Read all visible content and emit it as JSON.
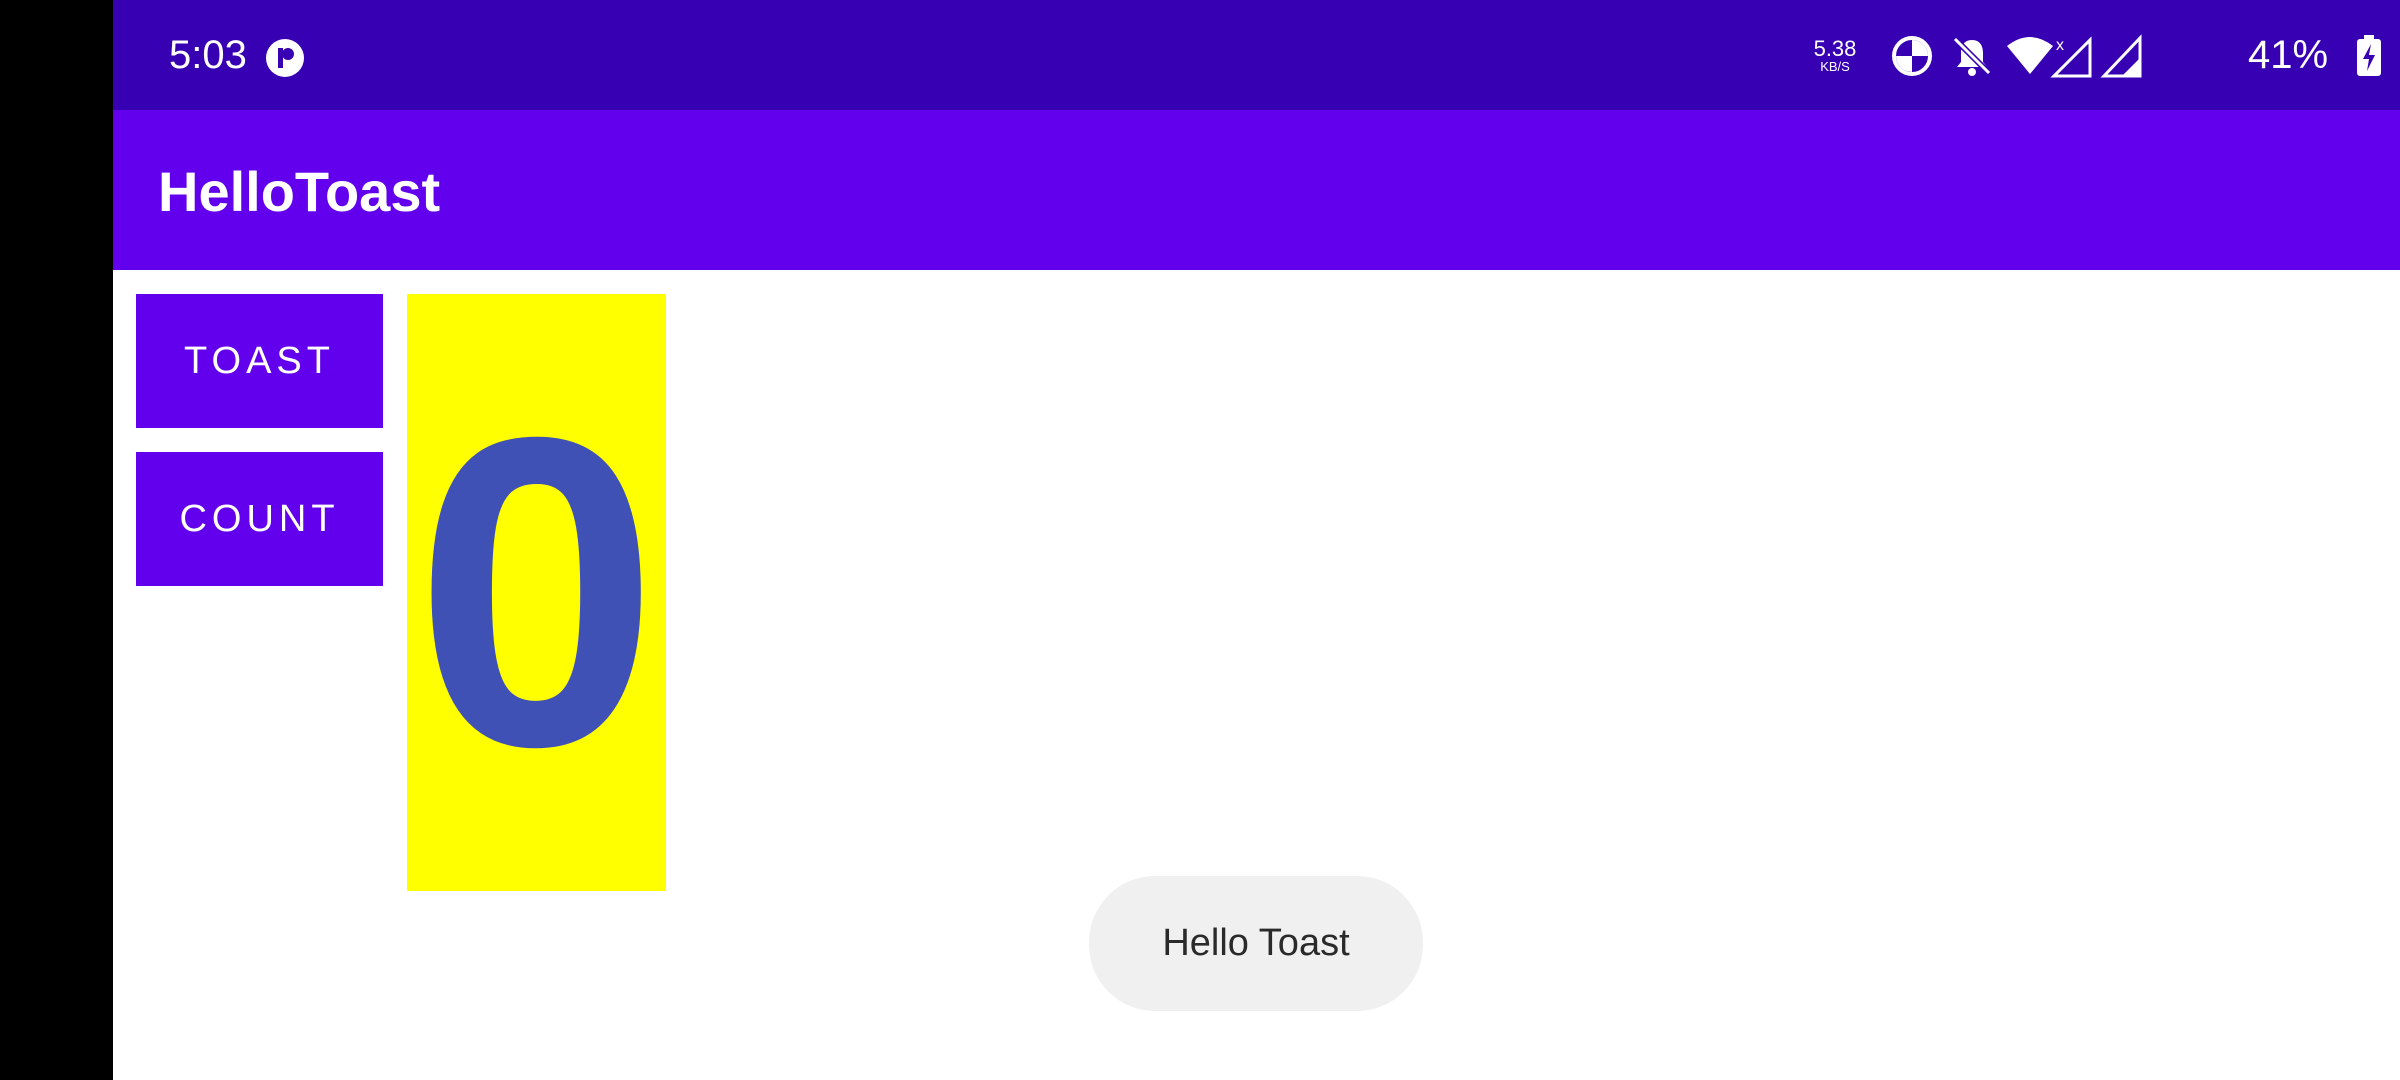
{
  "status_bar": {
    "time": "5:03",
    "network_speed_value": "5.38",
    "network_speed_unit": "KB/S",
    "battery_percent": "41%",
    "icons": [
      "app-notification-icon",
      "data-saver-icon",
      "do-not-disturb-icon",
      "wifi-icon",
      "signal-no-service-icon",
      "signal-icon",
      "battery-charging-icon"
    ]
  },
  "app_bar": {
    "title": "HelloToast"
  },
  "buttons": {
    "toast_label": "TOAST",
    "count_label": "COUNT"
  },
  "count_display": {
    "value": "0"
  },
  "toast": {
    "message": "Hello Toast"
  },
  "colors": {
    "status_bar": "#3700b3",
    "app_bar": "#6200ee",
    "count_background": "#ffff00",
    "count_text": "#3f51b5",
    "toast_background": "#f0f0f0"
  }
}
